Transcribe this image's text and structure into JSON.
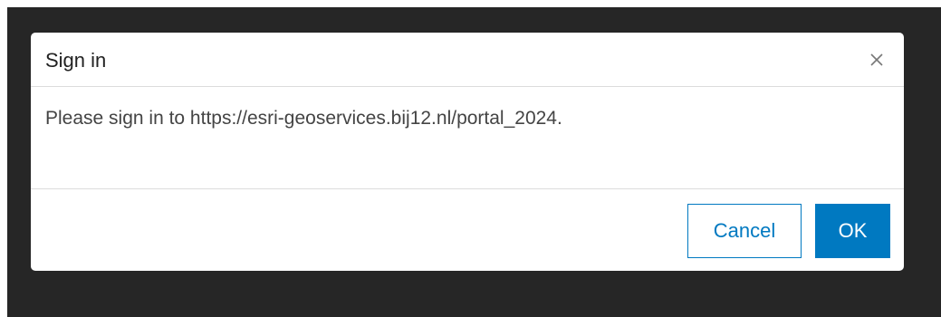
{
  "dialog": {
    "title": "Sign in",
    "message": "Please sign in to https://esri-geoservices.bij12.nl/portal_2024.",
    "close_icon": "close-icon"
  },
  "buttons": {
    "cancel_label": "Cancel",
    "ok_label": "OK"
  },
  "colors": {
    "accent": "#0079c1",
    "backdrop": "#262626"
  }
}
